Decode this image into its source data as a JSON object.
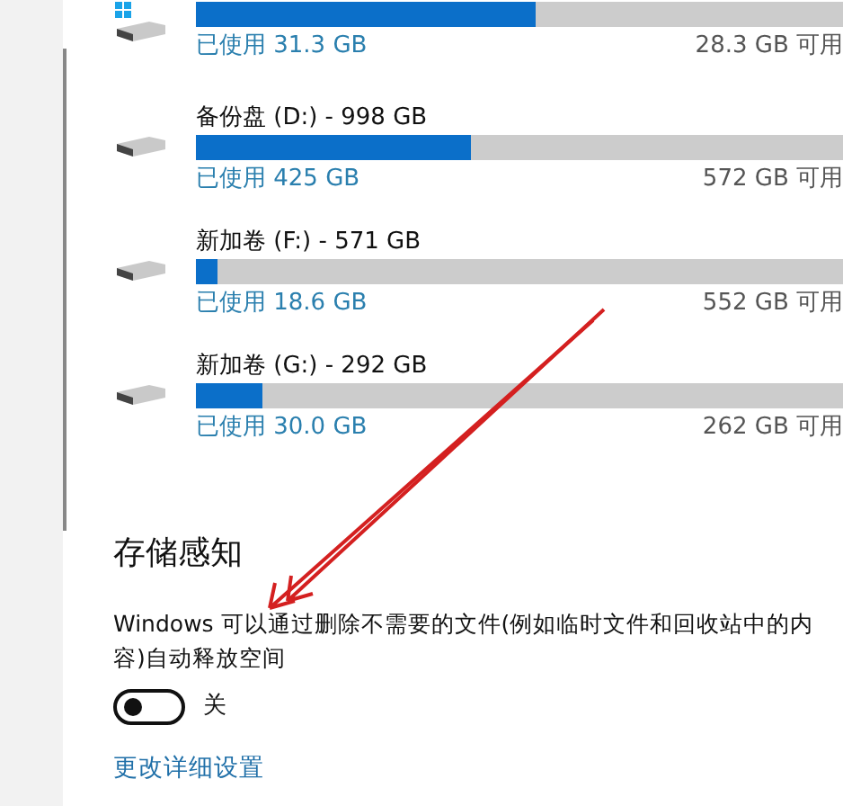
{
  "drives": [
    {
      "kind": "system",
      "level": 0.525,
      "used": "已使用 31.3 GB",
      "free": "28.3 GB 可用"
    },
    {
      "kind": "disk",
      "title": "备份盘 (D:) - 998 GB",
      "level": 0.426,
      "used": "已使用 425 GB",
      "free": "572 GB 可用"
    },
    {
      "kind": "disk",
      "title": "新加卷 (F:) - 571 GB",
      "level": 0.033,
      "used": "已使用 18.6 GB",
      "free": "552 GB 可用"
    },
    {
      "kind": "disk",
      "title": "新加卷 (G:) - 292 GB",
      "level": 0.103,
      "used": "已使用 30.0 GB",
      "free": "262 GB 可用"
    }
  ],
  "storage_sense": {
    "heading": "存储感知",
    "description": "Windows 可以通过删除不需要的文件(例如临时文件和回收站中的内容)自动释放空间",
    "toggle": {
      "on": false,
      "label": "关"
    },
    "link": "更改详细设置"
  }
}
